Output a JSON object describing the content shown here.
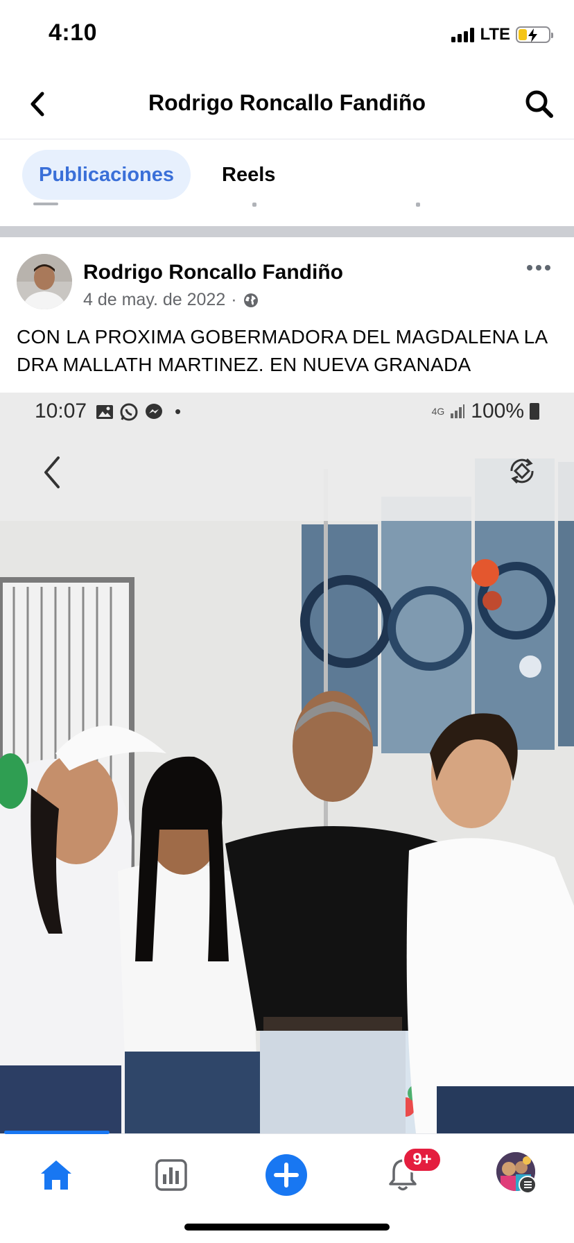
{
  "status_bar": {
    "time": "4:10",
    "network": "LTE"
  },
  "header": {
    "title": "Rodrigo Roncallo Fandiño",
    "back_icon": "chevron-left-icon",
    "search_icon": "search-icon"
  },
  "tabs": [
    {
      "label": "Publicaciones",
      "active": true
    },
    {
      "label": "Reels",
      "active": false
    }
  ],
  "post": {
    "author": "Rodrigo Roncallo Fandiño",
    "date": "4 de may. de 2022",
    "separator": "·",
    "privacy_icon": "globe-icon",
    "text": "CON LA PROXIMA GOBERMADORA DEL MAGDALENA LA DRA MALLATH MARTINEZ. EN NUEVA GRANADA",
    "photo": {
      "status_time": "10:07",
      "status_dot": "•",
      "network_small": "4G",
      "battery": "100%"
    }
  },
  "tab_bar": {
    "items": [
      "home-icon",
      "dashboard-icon",
      "create-icon",
      "notifications-icon",
      "profile-avatar"
    ],
    "notifications_badge": "9+"
  },
  "colors": {
    "accent": "#1877f2",
    "tab_active_bg": "#e7f0fd",
    "badge": "#e41e3f"
  }
}
